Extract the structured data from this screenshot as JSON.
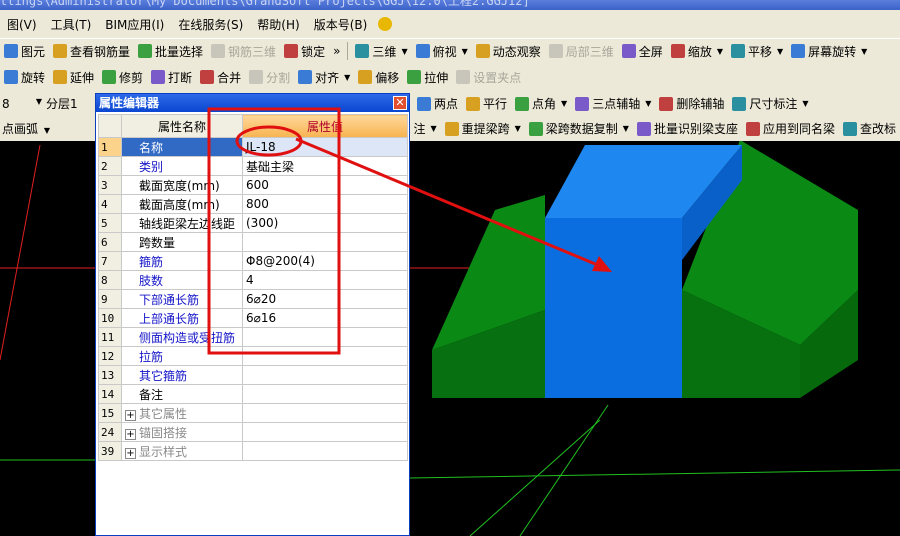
{
  "title": "ttings\\Administrator\\My Documents\\GrandSoft Projects\\GGJ\\12.0\\工程2.GGJ12]",
  "menu": [
    "图(V)",
    "工具(T)",
    "BIM应用(I)",
    "在线服务(S)",
    "帮助(H)",
    "版本号(B)"
  ],
  "toolbar1": [
    {
      "label": "图元",
      "dis": false
    },
    {
      "label": "查看钢筋量",
      "dis": false
    },
    {
      "label": "批量选择",
      "dis": false
    },
    {
      "label": "钢筋三维",
      "dis": true
    },
    {
      "label": "锁定",
      "dis": false
    },
    {
      "label": "三维",
      "dis": false,
      "dd": true
    },
    {
      "label": "俯视",
      "dis": false,
      "dd": true
    },
    {
      "label": "动态观察",
      "dis": false
    },
    {
      "label": "局部三维",
      "dis": true
    },
    {
      "label": "全屏",
      "dis": false
    },
    {
      "label": "缩放",
      "dis": false,
      "dd": true
    },
    {
      "label": "平移",
      "dis": false,
      "dd": true
    },
    {
      "label": "屏幕旋转",
      "dis": false,
      "dd": true
    }
  ],
  "toolbar2": [
    {
      "label": "旋转"
    },
    {
      "label": "延伸"
    },
    {
      "label": "修剪"
    },
    {
      "label": "打断"
    },
    {
      "label": "合并"
    },
    {
      "label": "分割",
      "dis": true
    },
    {
      "label": "对齐",
      "dd": true
    },
    {
      "label": "偏移"
    },
    {
      "label": "拉伸"
    },
    {
      "label": "设置夹点",
      "dis": true
    }
  ],
  "toolbar3": {
    "floor": "8",
    "layer": "分层1",
    "items": [
      {
        "label": "两点"
      },
      {
        "label": "平行"
      },
      {
        "label": "点角",
        "dd": true
      },
      {
        "label": "三点辅轴",
        "dd": true
      },
      {
        "label": "删除辅轴"
      },
      {
        "label": "尺寸标注",
        "dd": true
      }
    ]
  },
  "toolbar4": {
    "left": "点画弧",
    "items": [
      {
        "label": "注",
        "dd": true
      },
      {
        "label": "重提梁跨",
        "dd": true
      },
      {
        "label": "梁跨数据复制",
        "dd": true
      },
      {
        "label": "批量识别梁支座"
      },
      {
        "label": "应用到同名梁"
      },
      {
        "label": "查改标"
      }
    ]
  },
  "dialog": {
    "title": "属性编辑器",
    "col_name": "属性名称",
    "col_value": "属性值",
    "rows": [
      {
        "n": "1",
        "name": "名称",
        "value": "JL-18",
        "style": "blue",
        "sel": true
      },
      {
        "n": "2",
        "name": "类别",
        "value": "基础主梁",
        "style": "blue"
      },
      {
        "n": "3",
        "name": "截面宽度(mm)",
        "value": "600",
        "style": ""
      },
      {
        "n": "4",
        "name": "截面高度(mm)",
        "value": "800",
        "style": ""
      },
      {
        "n": "5",
        "name": "轴线距梁左边线距",
        "value": "(300)",
        "style": ""
      },
      {
        "n": "6",
        "name": "跨数量",
        "value": "",
        "style": ""
      },
      {
        "n": "7",
        "name": "箍筋",
        "value": "Φ8@200(4)",
        "style": "blue"
      },
      {
        "n": "8",
        "name": "肢数",
        "value": "4",
        "style": "blue"
      },
      {
        "n": "9",
        "name": "下部通长筋",
        "value": "6⌀20",
        "style": "blue"
      },
      {
        "n": "10",
        "name": "上部通长筋",
        "value": "6⌀16",
        "style": "blue"
      },
      {
        "n": "11",
        "name": "侧面构造或受扭筋",
        "value": "",
        "style": "blue"
      },
      {
        "n": "12",
        "name": "拉筋",
        "value": "",
        "style": "blue"
      },
      {
        "n": "13",
        "name": "其它箍筋",
        "value": "",
        "style": "blue"
      },
      {
        "n": "14",
        "name": "备注",
        "value": "",
        "style": ""
      },
      {
        "n": "15",
        "name": "其它属性",
        "value": "",
        "style": "gray",
        "plus": true
      },
      {
        "n": "24",
        "name": "锚固搭接",
        "value": "",
        "style": "gray",
        "plus": true
      },
      {
        "n": "39",
        "name": "显示样式",
        "value": "",
        "style": "gray",
        "plus": true
      }
    ]
  },
  "colors": {
    "beam_blue": "#0a6ee0",
    "slab_green": "#0a8a14",
    "annotation": "#e01010"
  }
}
